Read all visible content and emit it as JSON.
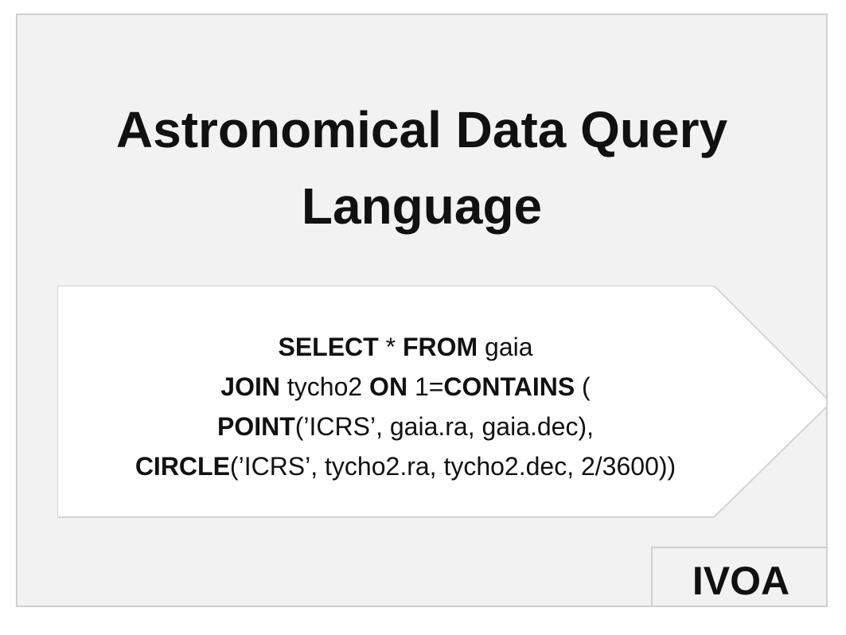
{
  "title": {
    "line1": "Astronomical Data Query",
    "line2": "Language"
  },
  "query": {
    "l1_kw1": "SELECT",
    "l1_t1": " * ",
    "l1_kw2": "FROM",
    "l1_t2": " gaia",
    "l2_kw1": "JOIN",
    "l2_t1": " tycho2 ",
    "l2_kw2": "ON",
    "l2_t2": " 1=",
    "l2_kw3": "CONTAINS",
    "l2_t3": " (",
    "l3_kw1": "POINT",
    "l3_t1": "(’ICRS’, gaia.ra, gaia.dec),",
    "l4_kw1": "CIRCLE",
    "l4_t1": "(’ICRS’, tycho2.ra, tycho2.dec, 2/3600))"
  },
  "badge": {
    "label": "IVOA"
  },
  "colors": {
    "background": "#f2f2f2",
    "arrow_fill": "#ffffff",
    "border": "#cfcfcf",
    "text": "#111111"
  }
}
